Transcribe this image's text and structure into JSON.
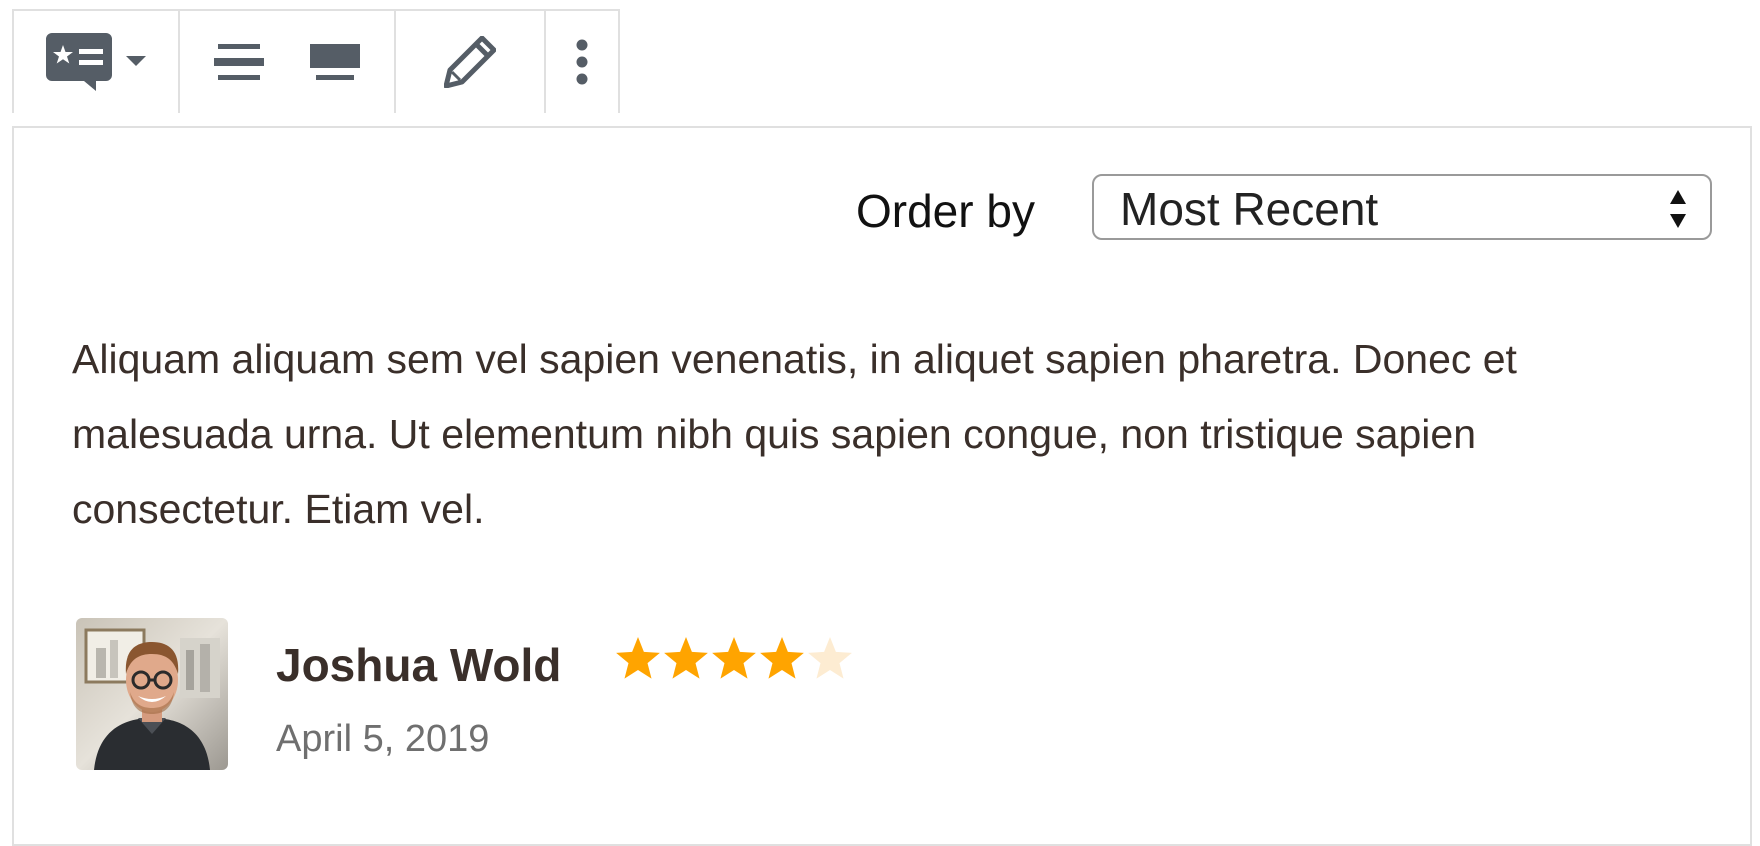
{
  "toolbar": {
    "block_type_icon": "testimonial-block-icon",
    "block_type_dropdown_icon": "caret-down-icon",
    "align_center_icon": "align-center-icon",
    "align_wide_icon": "align-wide-icon",
    "edit_icon": "pencil-icon",
    "more_icon": "vertical-ellipsis-icon",
    "icon_color": "#555d66"
  },
  "order": {
    "label": "Order by",
    "selected": "Most Recent"
  },
  "review": {
    "text": "Aliquam aliquam sem vel sapien venenatis, in aliquet sapien pharetra. Donec et malesuada urna. Ut elementum nibh quis sapien congue, non tristique sapien consectetur. Etiam vel.",
    "author": "Joshua Wold",
    "date": "April 5, 2019",
    "rating": 4,
    "rating_max": 5,
    "star_color": "#ffa400",
    "star_empty_color": "#fdecd2"
  }
}
